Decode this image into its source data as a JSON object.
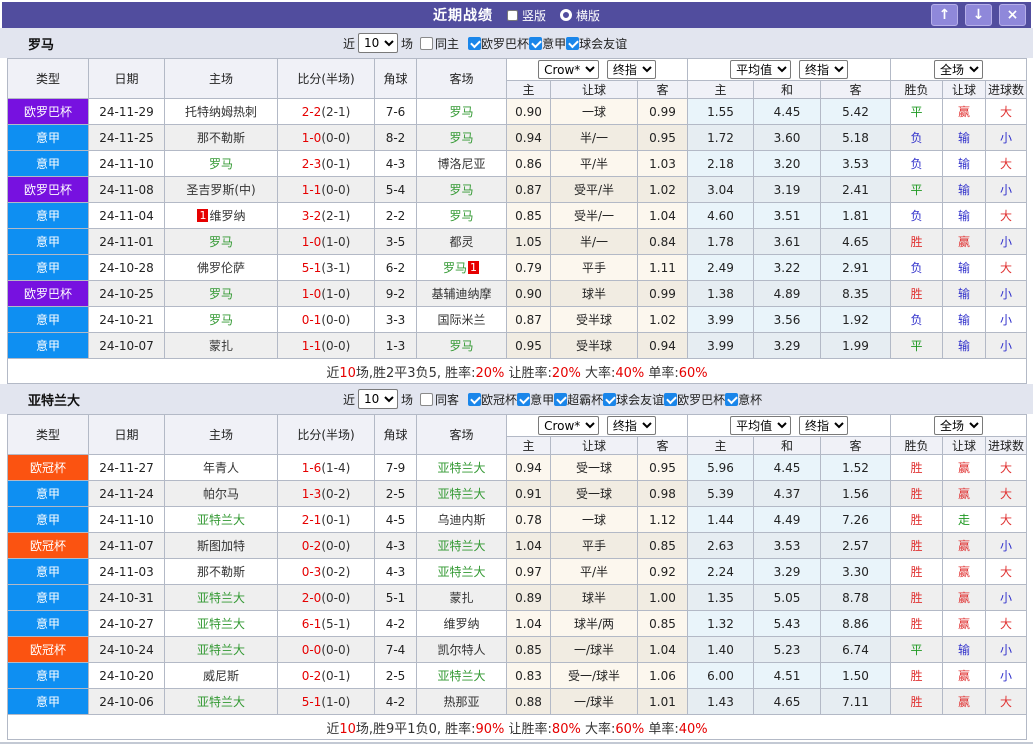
{
  "title_bar": {
    "title": "近期战绩",
    "radios": [
      {
        "label": "竖版",
        "selected": true
      },
      {
        "label": "横版",
        "selected": false
      }
    ],
    "up_icon": "↑",
    "down_icon": "↓",
    "close_icon": "×"
  },
  "columns": [
    "类型",
    "日期",
    "主场",
    "比分(半场)",
    "角球",
    "客场",
    "主",
    "让球",
    "客",
    "主",
    "和",
    "客",
    "胜负",
    "让球",
    "进球数"
  ],
  "league_colors": {
    "欧罗巴杯": "#7711e0",
    "意甲": "#0e8ff2",
    "欧冠杯": "#fb5311"
  },
  "result_colors": {
    "胜": "#e03333",
    "赢": "#e03333",
    "大": "#e03333",
    "平": "#1f9922",
    "走": "#1f9922",
    "负": "#3333cc",
    "输": "#3333cc",
    "小": "#3333cc"
  },
  "sections": [
    {
      "team": "罗马",
      "filter": {
        "near_label": "近",
        "matches": "10",
        "games_label": "场",
        "same_label": "同主",
        "same_checked": false,
        "leagues": [
          {
            "label": "欧罗巴杯",
            "checked": true
          },
          {
            "label": "意甲",
            "checked": true
          },
          {
            "label": "球会友谊",
            "checked": true
          }
        ]
      },
      "selects": {
        "odds_source": "Crow*",
        "odds_time": "终指",
        "avg": "平均值",
        "avg_time": "终指",
        "scope": "全场"
      },
      "rows": [
        {
          "league": "欧罗巴杯",
          "date": "24-11-29",
          "home": {
            "text": "托特纳姆热刺"
          },
          "score": "2-2",
          "half": "(2-1)",
          "corner": "7-6",
          "away": {
            "text": "罗马",
            "focus": true
          },
          "odds": [
            "0.90",
            "一球",
            "0.99"
          ],
          "avg": [
            "1.55",
            "4.45",
            "5.42"
          ],
          "results": [
            "平",
            "赢",
            "大"
          ]
        },
        {
          "league": "意甲",
          "date": "24-11-25",
          "home": {
            "text": "那不勒斯"
          },
          "score": "1-0",
          "half": "(0-0)",
          "corner": "8-2",
          "away": {
            "text": "罗马",
            "focus": true
          },
          "odds": [
            "0.94",
            "半/一",
            "0.95"
          ],
          "avg": [
            "1.72",
            "3.60",
            "5.18"
          ],
          "results": [
            "负",
            "输",
            "小"
          ]
        },
        {
          "league": "意甲",
          "date": "24-11-10",
          "home": {
            "text": "罗马",
            "focus": true
          },
          "score": "2-3",
          "half": "(0-1)",
          "corner": "4-3",
          "away": {
            "text": "博洛尼亚"
          },
          "odds": [
            "0.86",
            "平/半",
            "1.03"
          ],
          "avg": [
            "2.18",
            "3.20",
            "3.53"
          ],
          "results": [
            "负",
            "输",
            "大"
          ]
        },
        {
          "league": "欧罗巴杯",
          "date": "24-11-08",
          "home": {
            "text": "圣吉罗斯(中)"
          },
          "score": "1-1",
          "half": "(0-0)",
          "corner": "5-4",
          "away": {
            "text": "罗马",
            "focus": true
          },
          "odds": [
            "0.87",
            "受平/半",
            "1.02"
          ],
          "avg": [
            "3.04",
            "3.19",
            "2.41"
          ],
          "results": [
            "平",
            "输",
            "小"
          ]
        },
        {
          "league": "意甲",
          "date": "24-11-04",
          "home": {
            "text": "维罗纳",
            "badge": "1",
            "badge_pos": "before"
          },
          "score": "3-2",
          "half": "(2-1)",
          "corner": "2-2",
          "away": {
            "text": "罗马",
            "focus": true
          },
          "odds": [
            "0.85",
            "受半/一",
            "1.04"
          ],
          "avg": [
            "4.60",
            "3.51",
            "1.81"
          ],
          "results": [
            "负",
            "输",
            "大"
          ]
        },
        {
          "league": "意甲",
          "date": "24-11-01",
          "home": {
            "text": "罗马",
            "focus": true
          },
          "score": "1-0",
          "half": "(1-0)",
          "corner": "3-5",
          "away": {
            "text": "都灵"
          },
          "odds": [
            "1.05",
            "半/一",
            "0.84"
          ],
          "avg": [
            "1.78",
            "3.61",
            "4.65"
          ],
          "results": [
            "胜",
            "赢",
            "小"
          ]
        },
        {
          "league": "意甲",
          "date": "24-10-28",
          "home": {
            "text": "佛罗伦萨"
          },
          "score": "5-1",
          "half": "(3-1)",
          "corner": "6-2",
          "away": {
            "text": "罗马",
            "focus": true,
            "badge": "1",
            "badge_pos": "after"
          },
          "odds": [
            "0.79",
            "平手",
            "1.11"
          ],
          "avg": [
            "2.49",
            "3.22",
            "2.91"
          ],
          "results": [
            "负",
            "输",
            "大"
          ]
        },
        {
          "league": "欧罗巴杯",
          "date": "24-10-25",
          "home": {
            "text": "罗马",
            "focus": true
          },
          "score": "1-0",
          "half": "(1-0)",
          "corner": "9-2",
          "away": {
            "text": "基辅迪纳摩"
          },
          "odds": [
            "0.90",
            "球半",
            "0.99"
          ],
          "avg": [
            "1.38",
            "4.89",
            "8.35"
          ],
          "results": [
            "胜",
            "输",
            "小"
          ]
        },
        {
          "league": "意甲",
          "date": "24-10-21",
          "home": {
            "text": "罗马",
            "focus": true
          },
          "score": "0-1",
          "half": "(0-0)",
          "corner": "3-3",
          "away": {
            "text": "国际米兰"
          },
          "odds": [
            "0.87",
            "受半球",
            "1.02"
          ],
          "avg": [
            "3.99",
            "3.56",
            "1.92"
          ],
          "results": [
            "负",
            "输",
            "小"
          ]
        },
        {
          "league": "意甲",
          "date": "24-10-07",
          "home": {
            "text": "蒙扎"
          },
          "score": "1-1",
          "half": "(0-0)",
          "corner": "1-3",
          "away": {
            "text": "罗马",
            "focus": true
          },
          "odds": [
            "0.95",
            "受半球",
            "0.94"
          ],
          "avg": [
            "3.99",
            "3.29",
            "1.99"
          ],
          "results": [
            "平",
            "输",
            "小"
          ]
        }
      ],
      "summary": [
        {
          "text": "近"
        },
        {
          "text": "10",
          "red": true
        },
        {
          "text": "场,胜2平3负5, 胜率:"
        },
        {
          "text": "20%",
          "red": true
        },
        {
          "text": " 让胜率:"
        },
        {
          "text": "20%",
          "red": true
        },
        {
          "text": " 大率:"
        },
        {
          "text": "40%",
          "red": true
        },
        {
          "text": " 单率:"
        },
        {
          "text": "60%",
          "red": true
        }
      ]
    },
    {
      "team": "亚特兰大",
      "filter": {
        "near_label": "近",
        "matches": "10",
        "games_label": "场",
        "same_label": "同客",
        "same_checked": false,
        "leagues": [
          {
            "label": "欧冠杯",
            "checked": true
          },
          {
            "label": "意甲",
            "checked": true
          },
          {
            "label": "超霸杯",
            "checked": true
          },
          {
            "label": "球会友谊",
            "checked": true
          },
          {
            "label": "欧罗巴杯",
            "checked": true
          },
          {
            "label": "意杯",
            "checked": true
          }
        ]
      },
      "selects": {
        "odds_source": "Crow*",
        "odds_time": "终指",
        "avg": "平均值",
        "avg_time": "终指",
        "scope": "全场"
      },
      "rows": [
        {
          "league": "欧冠杯",
          "date": "24-11-27",
          "home": {
            "text": "年青人"
          },
          "score": "1-6",
          "half": "(1-4)",
          "corner": "7-9",
          "away": {
            "text": "亚特兰大",
            "focus": true
          },
          "odds": [
            "0.94",
            "受一球",
            "0.95"
          ],
          "avg": [
            "5.96",
            "4.45",
            "1.52"
          ],
          "results": [
            "胜",
            "赢",
            "大"
          ]
        },
        {
          "league": "意甲",
          "date": "24-11-24",
          "home": {
            "text": "帕尔马"
          },
          "score": "1-3",
          "half": "(0-2)",
          "corner": "2-5",
          "away": {
            "text": "亚特兰大",
            "focus": true
          },
          "odds": [
            "0.91",
            "受一球",
            "0.98"
          ],
          "avg": [
            "5.39",
            "4.37",
            "1.56"
          ],
          "results": [
            "胜",
            "赢",
            "大"
          ]
        },
        {
          "league": "意甲",
          "date": "24-11-10",
          "home": {
            "text": "亚特兰大",
            "focus": true
          },
          "score": "2-1",
          "half": "(0-1)",
          "corner": "4-5",
          "away": {
            "text": "乌迪内斯"
          },
          "odds": [
            "0.78",
            "一球",
            "1.12"
          ],
          "avg": [
            "1.44",
            "4.49",
            "7.26"
          ],
          "results": [
            "胜",
            "走",
            "大"
          ]
        },
        {
          "league": "欧冠杯",
          "date": "24-11-07",
          "home": {
            "text": "斯图加特"
          },
          "score": "0-2",
          "half": "(0-0)",
          "corner": "4-3",
          "away": {
            "text": "亚特兰大",
            "focus": true
          },
          "odds": [
            "1.04",
            "平手",
            "0.85"
          ],
          "avg": [
            "2.63",
            "3.53",
            "2.57"
          ],
          "results": [
            "胜",
            "赢",
            "小"
          ]
        },
        {
          "league": "意甲",
          "date": "24-11-03",
          "home": {
            "text": "那不勒斯"
          },
          "score": "0-3",
          "half": "(0-2)",
          "corner": "4-3",
          "away": {
            "text": "亚特兰大",
            "focus": true
          },
          "odds": [
            "0.97",
            "平/半",
            "0.92"
          ],
          "avg": [
            "2.24",
            "3.29",
            "3.30"
          ],
          "results": [
            "胜",
            "赢",
            "大"
          ]
        },
        {
          "league": "意甲",
          "date": "24-10-31",
          "home": {
            "text": "亚特兰大",
            "focus": true
          },
          "score": "2-0",
          "half": "(0-0)",
          "corner": "5-1",
          "away": {
            "text": "蒙扎"
          },
          "odds": [
            "0.89",
            "球半",
            "1.00"
          ],
          "avg": [
            "1.35",
            "5.05",
            "8.78"
          ],
          "results": [
            "胜",
            "赢",
            "小"
          ]
        },
        {
          "league": "意甲",
          "date": "24-10-27",
          "home": {
            "text": "亚特兰大",
            "focus": true
          },
          "score": "6-1",
          "half": "(5-1)",
          "corner": "4-2",
          "away": {
            "text": "维罗纳"
          },
          "odds": [
            "1.04",
            "球半/两",
            "0.85"
          ],
          "avg": [
            "1.32",
            "5.43",
            "8.86"
          ],
          "results": [
            "胜",
            "赢",
            "大"
          ]
        },
        {
          "league": "欧冠杯",
          "date": "24-10-24",
          "home": {
            "text": "亚特兰大",
            "focus": true
          },
          "score": "0-0",
          "half": "(0-0)",
          "corner": "7-4",
          "away": {
            "text": "凯尔特人"
          },
          "odds": [
            "0.85",
            "一/球半",
            "1.04"
          ],
          "avg": [
            "1.40",
            "5.23",
            "6.74"
          ],
          "results": [
            "平",
            "输",
            "小"
          ]
        },
        {
          "league": "意甲",
          "date": "24-10-20",
          "home": {
            "text": "威尼斯"
          },
          "score": "0-2",
          "half": "(0-1)",
          "corner": "2-5",
          "away": {
            "text": "亚特兰大",
            "focus": true
          },
          "odds": [
            "0.83",
            "受一/球半",
            "1.06"
          ],
          "avg": [
            "6.00",
            "4.51",
            "1.50"
          ],
          "results": [
            "胜",
            "赢",
            "小"
          ]
        },
        {
          "league": "意甲",
          "date": "24-10-06",
          "home": {
            "text": "亚特兰大",
            "focus": true
          },
          "score": "5-1",
          "half": "(1-0)",
          "corner": "4-2",
          "away": {
            "text": "热那亚"
          },
          "odds": [
            "0.88",
            "一/球半",
            "1.01"
          ],
          "avg": [
            "1.43",
            "4.65",
            "7.11"
          ],
          "results": [
            "胜",
            "赢",
            "大"
          ]
        }
      ],
      "summary": [
        {
          "text": "近"
        },
        {
          "text": "10",
          "red": true
        },
        {
          "text": "场,胜9平1负0, 胜率:"
        },
        {
          "text": "90%",
          "red": true
        },
        {
          "text": " 让胜率:"
        },
        {
          "text": "80%",
          "red": true
        },
        {
          "text": " 大率:"
        },
        {
          "text": "60%",
          "red": true
        },
        {
          "text": " 单率:"
        },
        {
          "text": "40%",
          "red": true
        }
      ]
    }
  ]
}
